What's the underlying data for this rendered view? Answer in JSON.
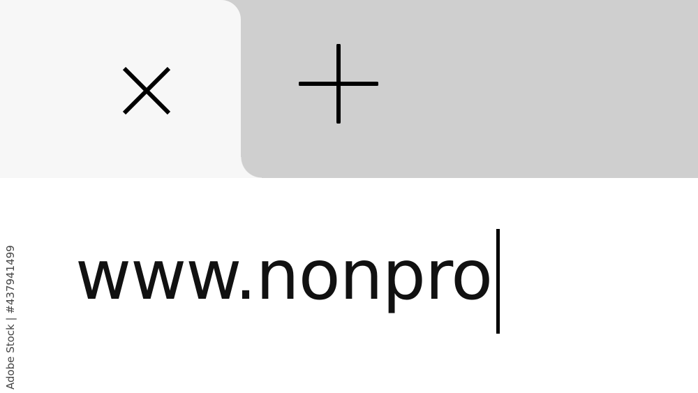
{
  "browser": {
    "tab_bar": {
      "active_tab_close": "close-icon",
      "new_tab": "plus-icon"
    },
    "address_bar": {
      "value": "www.nonpro"
    }
  },
  "watermark": {
    "text": "Adobe Stock | #437941499"
  },
  "colors": {
    "tab_strip": "#cfcfcf",
    "active_tab": "#f7f7f7",
    "page": "#ffffff",
    "text": "#111111"
  }
}
